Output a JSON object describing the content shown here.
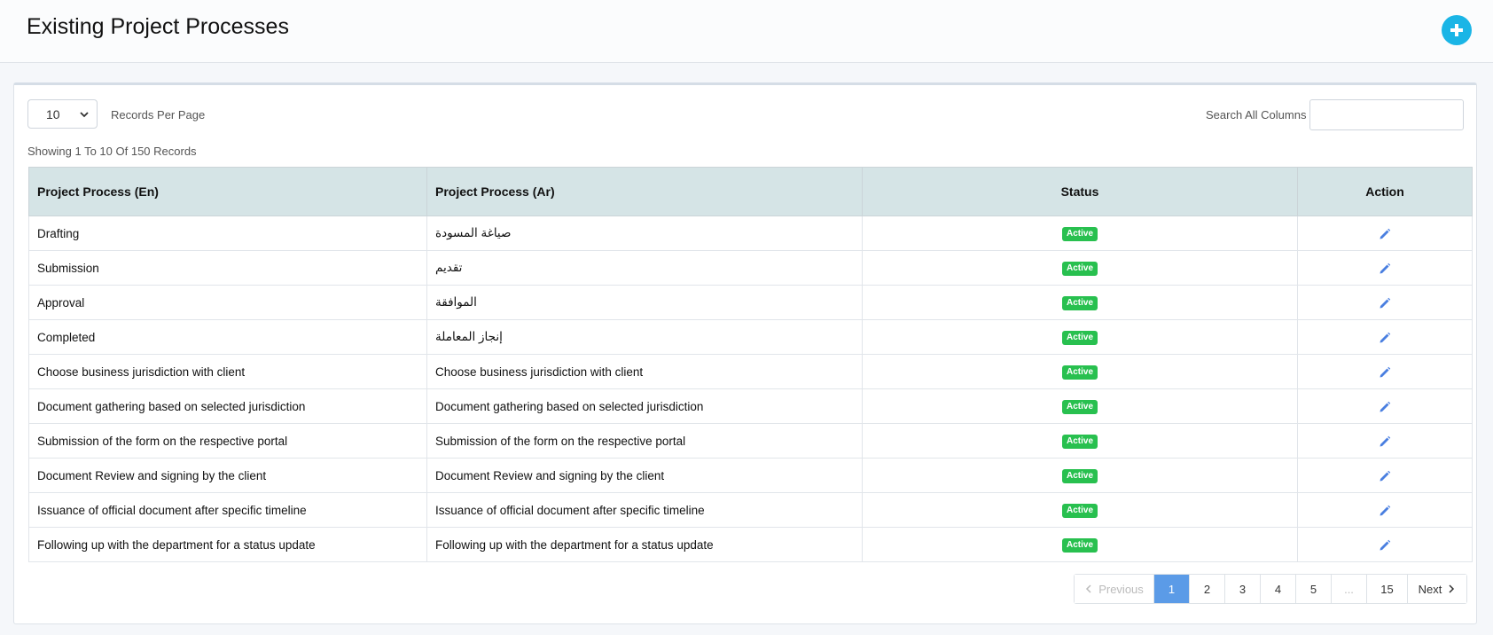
{
  "header": {
    "title": "Existing Project Processes",
    "add_icon": "plus-circle-icon"
  },
  "controls": {
    "per_page_value": "10",
    "per_page_label": "Records Per Page",
    "search_label": "Search All Columns",
    "search_value": "",
    "showing_text": "Showing 1 To 10 Of 150 Records"
  },
  "table": {
    "headers": [
      "Project Process (En)",
      "Project Process (Ar)",
      "Status",
      "Action"
    ],
    "rows": [
      {
        "en": "Drafting",
        "ar": "صياغة المسودة",
        "status": "Active"
      },
      {
        "en": "Submission",
        "ar": "تقديم",
        "status": "Active"
      },
      {
        "en": "Approval",
        "ar": "الموافقة",
        "status": "Active"
      },
      {
        "en": "Completed",
        "ar": "إنجاز المعاملة",
        "status": "Active"
      },
      {
        "en": "Choose business jurisdiction with client",
        "ar": "Choose business jurisdiction with client",
        "status": "Active"
      },
      {
        "en": "Document gathering based on selected jurisdiction",
        "ar": "Document gathering based on selected jurisdiction",
        "status": "Active"
      },
      {
        "en": "Submission of the form on the respective portal",
        "ar": "Submission of the form on the respective portal",
        "status": "Active"
      },
      {
        "en": "Document Review and signing by the client",
        "ar": "Document Review and signing by the client",
        "status": "Active"
      },
      {
        "en": "Issuance of official document after specific timeline",
        "ar": "Issuance of official document after specific timeline",
        "status": "Active"
      },
      {
        "en": "Following up with the department for a status update",
        "ar": "Following up with the department for a status update",
        "status": "Active"
      }
    ],
    "action_icon": "pencil-icon"
  },
  "pagination": {
    "previous": "Previous",
    "next": "Next",
    "pages": [
      "1",
      "2",
      "3",
      "4",
      "5",
      "...",
      "15"
    ],
    "current": "1"
  },
  "colors": {
    "accent": "#1ab5e6",
    "header_bg": "#d5e4e6",
    "active_badge": "#28c04f",
    "active_page": "#5b9be7",
    "edit_icon": "#4a7fe0"
  }
}
